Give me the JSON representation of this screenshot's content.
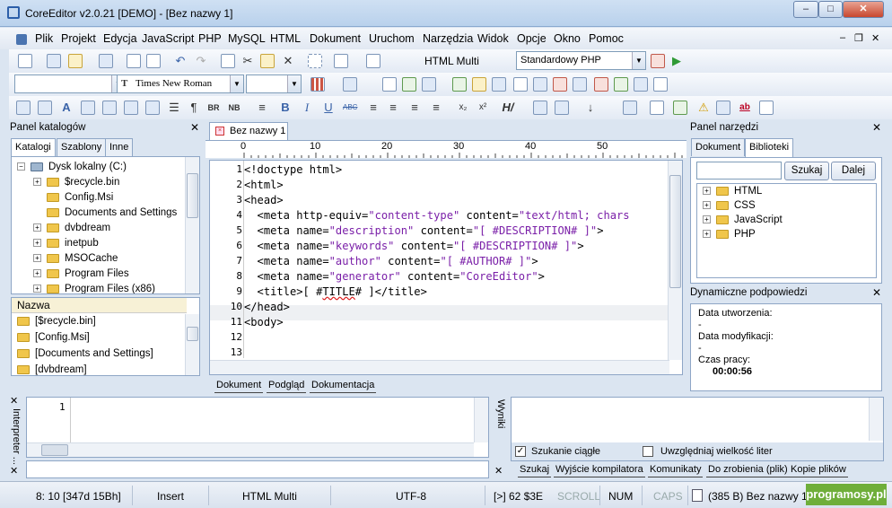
{
  "window": {
    "title": "CoreEditor v2.0.21 [DEMO] - [Bez nazwy 1]"
  },
  "menu": [
    "Plik",
    "Projekt",
    "Edycja",
    "JavaScript",
    "PHP",
    "MySQL",
    "HTML",
    "Dokument",
    "Uruchom",
    "Narzędzia",
    "Widok",
    "Opcje",
    "Okno",
    "Pomoc"
  ],
  "toolbar": {
    "mode_label": "HTML Multi",
    "php_combo": "Standardowy PHP",
    "font_combo": "Times New Roman"
  },
  "left_panel": {
    "title": "Panel katalogów",
    "tabs": [
      "Katalogi",
      "Szablony",
      "Inne"
    ],
    "tree_root": "Dysk lokalny (C:)",
    "tree_items": [
      "$recycle.bin",
      "Config.Msi",
      "Documents and Settings",
      "dvbdream",
      "inetpub",
      "MSOCache",
      "Program Files",
      "Program Files (x86)"
    ],
    "files_header": "Nazwa",
    "files": [
      "[$recycle.bin]",
      "[Config.Msi]",
      "[Documents and Settings]",
      "[dvbdream]"
    ]
  },
  "editor": {
    "tab": "Bez nazwy 1",
    "ruler": [
      "0",
      "10",
      "20",
      "30",
      "40",
      "50"
    ],
    "line_numbers": [
      "1",
      "2",
      "3",
      "4",
      "5",
      "6",
      "7",
      "8",
      "9",
      "10",
      "11",
      "12",
      "13"
    ],
    "bottom_tabs": [
      "Dokument",
      "Podgląd",
      "Dokumentacja"
    ]
  },
  "right_panel": {
    "title": "Panel narzędzi",
    "tabs": [
      "Dokument",
      "Biblioteki"
    ],
    "search_button": "Szukaj",
    "next_button": "Dalej",
    "libraries": [
      "HTML",
      "CSS",
      "JavaScript",
      "PHP"
    ],
    "hints_title": "Dynamiczne podpowiedzi",
    "created_label": "Data utworzenia:",
    "created_value": "-",
    "modified_label": "Data modyfikacji:",
    "modified_value": "-",
    "worktime_label": "Czas pracy:",
    "worktime_value": "00:00:56"
  },
  "interpreter": {
    "label": "Interpreter ...",
    "line": "1"
  },
  "results": {
    "label": "Wyniki",
    "continuous": "Szukanie ciągłe",
    "case": "Uwzględniaj wielkość liter",
    "tabs": [
      "Szukaj",
      "Wyjście kompilatora",
      "Komunikaty",
      "Do zrobienia (plik)",
      "Kopie plików"
    ]
  },
  "status": {
    "position": "8: 10 [347d 15Bh]",
    "insert": "Insert",
    "mode": "HTML Multi",
    "encoding": "UTF-8",
    "char": "[>] 62 $3E",
    "scroll": "SCROLL",
    "num": "NUM",
    "caps": "CAPS",
    "file": "(385 B) Bez nazwy 1",
    "brand": "programosy.pl"
  }
}
